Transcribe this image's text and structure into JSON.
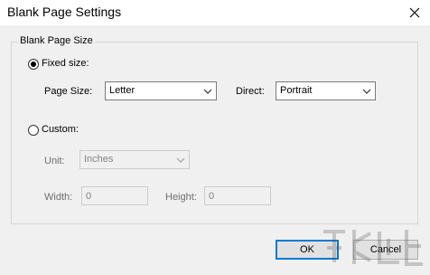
{
  "window": {
    "title": "Blank Page Settings"
  },
  "group": {
    "title": "Blank Page Size"
  },
  "fixed": {
    "label": "Fixed size:",
    "selected": true,
    "page_size_label": "Page Size:",
    "page_size_value": "Letter",
    "direct_label": "Direct:",
    "direct_value": "Portrait"
  },
  "custom": {
    "label": "Custom:",
    "selected": false,
    "unit_label": "Unit:",
    "unit_value": "Inches",
    "width_label": "Width:",
    "width_value": "0",
    "height_label": "Height:",
    "height_value": "0"
  },
  "buttons": {
    "ok": "OK",
    "cancel": "Cancel"
  },
  "icons": {
    "close": "close-icon",
    "dropdown": "chevron-down-icon"
  },
  "colors": {
    "accent": "#0078d7",
    "background": "#f0f0f0"
  }
}
